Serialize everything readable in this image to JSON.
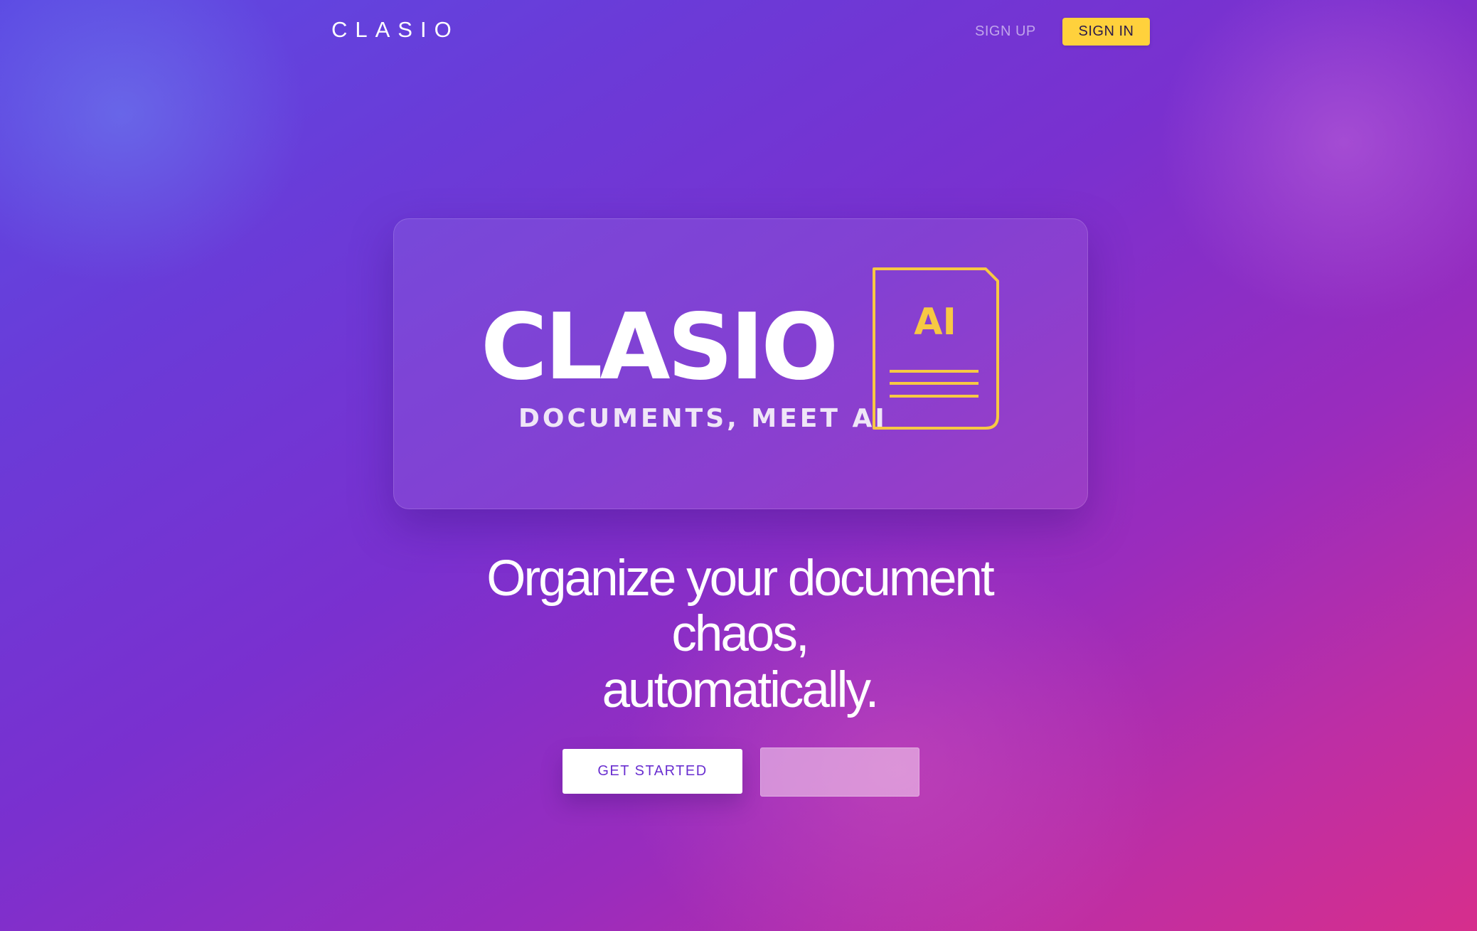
{
  "nav": {
    "logo": "CLASIO",
    "sign_up": "SIGN UP",
    "sign_in": "SIGN IN"
  },
  "hero": {
    "brand_name": "CLASIO",
    "tagline": "DOCUMENTS, MEET AI",
    "badge": "AI"
  },
  "headline": {
    "line1": "Organize your document",
    "line2": "chaos,",
    "line3": "automatically."
  },
  "cta": {
    "primary": "GET STARTED",
    "secondary": ""
  },
  "colors": {
    "accent_yellow": "#ffd13c",
    "gradient_start": "#5c4ae3",
    "gradient_end": "#d62e8c",
    "primary_button_text": "#6a2fd0"
  },
  "icons": {
    "document": "document-ai-icon"
  }
}
